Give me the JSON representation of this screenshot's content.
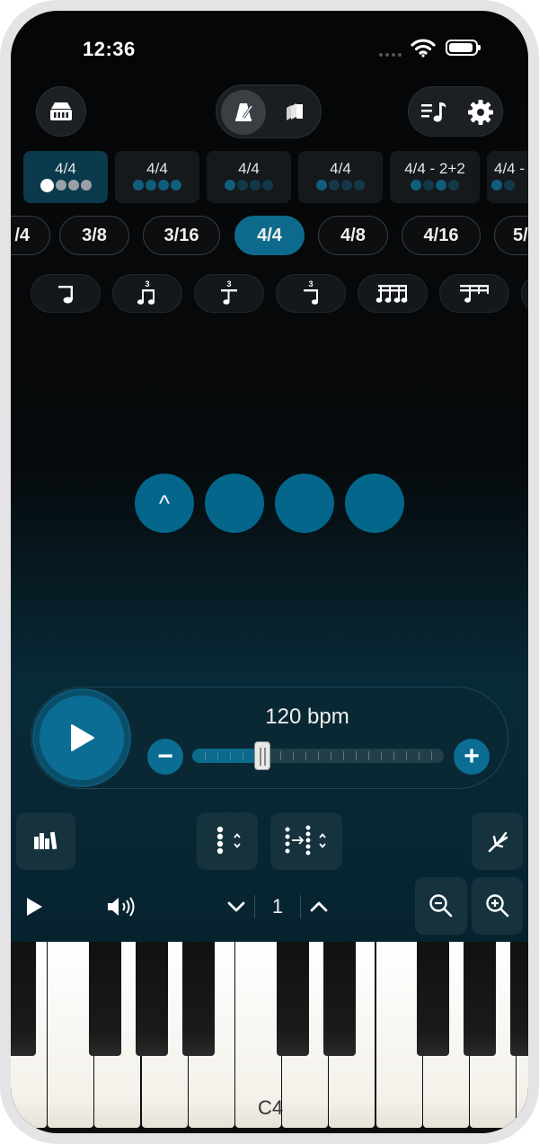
{
  "status_bar": {
    "time": "12:36"
  },
  "presets": [
    {
      "label": "4/4",
      "selected": true
    },
    {
      "label": "4/4",
      "selected": false
    },
    {
      "label": "4/4",
      "selected": false
    },
    {
      "label": "4/4",
      "selected": false
    },
    {
      "label": "4/4 - 2+2",
      "selected": false
    },
    {
      "label": "4/4 -",
      "selected": false
    }
  ],
  "meters": [
    "/4",
    "3/8",
    "3/16",
    "4/4",
    "4/8",
    "4/16",
    "5/"
  ],
  "selected_meter": "4/4",
  "beat_circles": {
    "accent_symbol": "^",
    "count": 4
  },
  "tempo": {
    "bpm_label": "120 bpm",
    "bpm": 120,
    "minus": "−",
    "plus": "+",
    "slider_fraction": 0.28
  },
  "octave": {
    "value": "1"
  },
  "piano": {
    "middle_c_label": "C4"
  },
  "colors": {
    "accent": "#0b6d93",
    "background": "#050607"
  }
}
